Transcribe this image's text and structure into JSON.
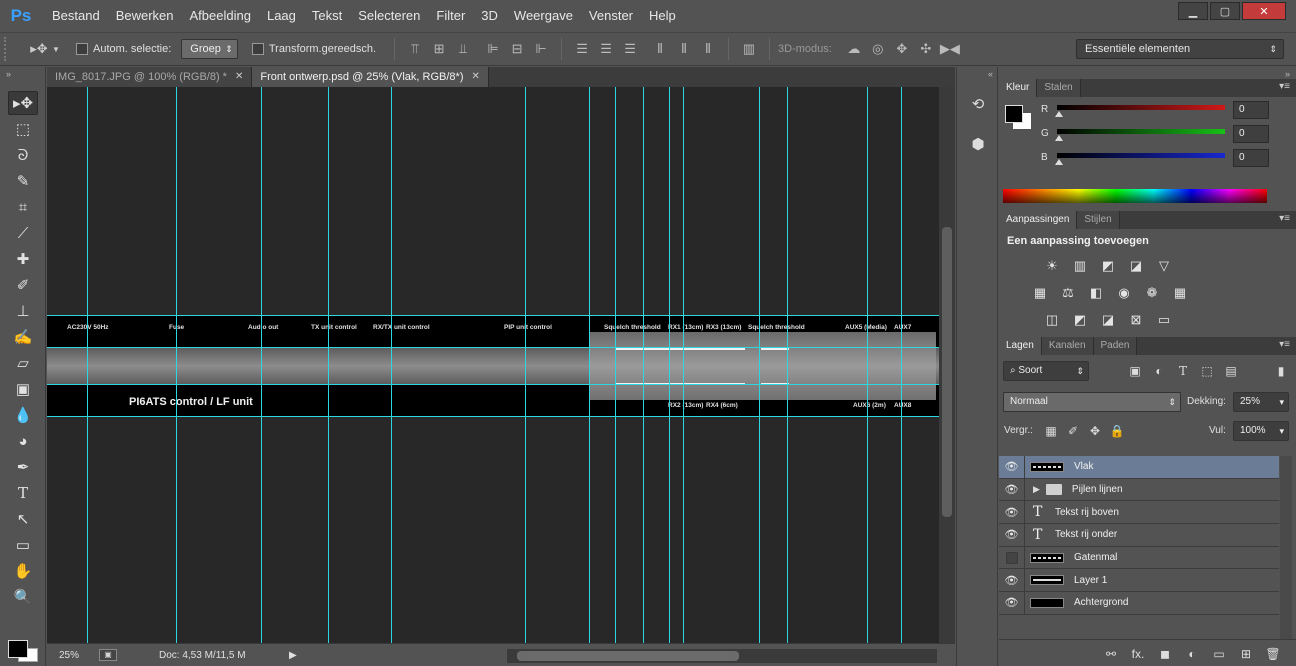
{
  "app": {
    "logo": "Ps"
  },
  "menu": [
    "Bestand",
    "Bewerken",
    "Afbeelding",
    "Laag",
    "Tekst",
    "Selecteren",
    "Filter",
    "3D",
    "Weergave",
    "Venster",
    "Help"
  ],
  "window_controls": {
    "minimize": "▁",
    "maximize": "▢",
    "close": "✕"
  },
  "options": {
    "auto_select_label": "Autom. selectie:",
    "auto_select_value": "Groep",
    "transform_label": "Transform.gereedsch.",
    "mode3d_label": "3D-modus:",
    "workspace": "Essentiële elementen"
  },
  "tabs": [
    {
      "label": "IMG_8017.JPG @ 100% (RGB/8) *",
      "close": "✕"
    },
    {
      "label": "Front ontwerp.psd @ 25% (Vlak, RGB/8*)",
      "close": "✕"
    }
  ],
  "canvas": {
    "title": "PI6ATS control / LF unit",
    "top_labels": [
      "AC230V 50Hz",
      "Fuse",
      "Audio out",
      "TX unit control",
      "RX/TX unit control",
      "PIP unit control",
      "Squelch threshold",
      "RX1 (13cm)",
      "RX3 (13cm)",
      "Squelch threshold",
      "AUX5 (Media)",
      "AUX7"
    ],
    "bottom_labels": [
      "RX2 (13cm)",
      "RX4 (6cm)",
      "AUX6 (2m)",
      "AUX8"
    ]
  },
  "status": {
    "zoom": "25%",
    "doc": "Doc: 4,53 M/11,5 M",
    "arrow": "▶"
  },
  "kleur": {
    "tabs": [
      "Kleur",
      "Stalen"
    ],
    "menu": "▾≡",
    "sliders": [
      {
        "label": "R",
        "value": "0",
        "color": "#d01818"
      },
      {
        "label": "G",
        "value": "0",
        "color": "#18c018"
      },
      {
        "label": "B",
        "value": "0",
        "color": "#1828d0"
      }
    ]
  },
  "aanpassingen": {
    "tabs": [
      "Aanpassingen",
      "Stijlen"
    ],
    "title": "Een aanpassing toevoegen",
    "row1": [
      "☀",
      "▥",
      "◩",
      "◪",
      "▽"
    ],
    "row2": [
      "▦",
      "⚖",
      "◧",
      "◉",
      "❁",
      "▦"
    ],
    "row3": [
      "◫",
      "◩",
      "◪",
      "⊠",
      "▭"
    ]
  },
  "lagen": {
    "tabs": [
      "Lagen",
      "Kanalen",
      "Paden"
    ],
    "filter": "Soort",
    "blend_mode": "Normaal",
    "opacity_label": "Dekking:",
    "opacity_value": "25%",
    "lock_label": "Vergr.:",
    "fill_label": "Vul:",
    "fill_value": "100%",
    "layers": [
      {
        "name": "Vlak",
        "kind": "dashed",
        "visible": true,
        "selected": true
      },
      {
        "name": "Pijlen lijnen",
        "kind": "folder",
        "visible": true,
        "selected": false
      },
      {
        "name": "Tekst rij boven",
        "kind": "text",
        "visible": true,
        "selected": false
      },
      {
        "name": "Tekst rij onder",
        "kind": "text",
        "visible": true,
        "selected": false
      },
      {
        "name": "Gatenmal",
        "kind": "dashed",
        "visible": false,
        "selected": false
      },
      {
        "name": "Layer 1",
        "kind": "line",
        "visible": true,
        "selected": false
      },
      {
        "name": "Achtergrond",
        "kind": "fill",
        "visible": true,
        "selected": false
      }
    ],
    "footer": [
      "⚯",
      "fx.",
      "◼",
      "◐",
      "▭",
      "⊞",
      "🗑"
    ]
  }
}
